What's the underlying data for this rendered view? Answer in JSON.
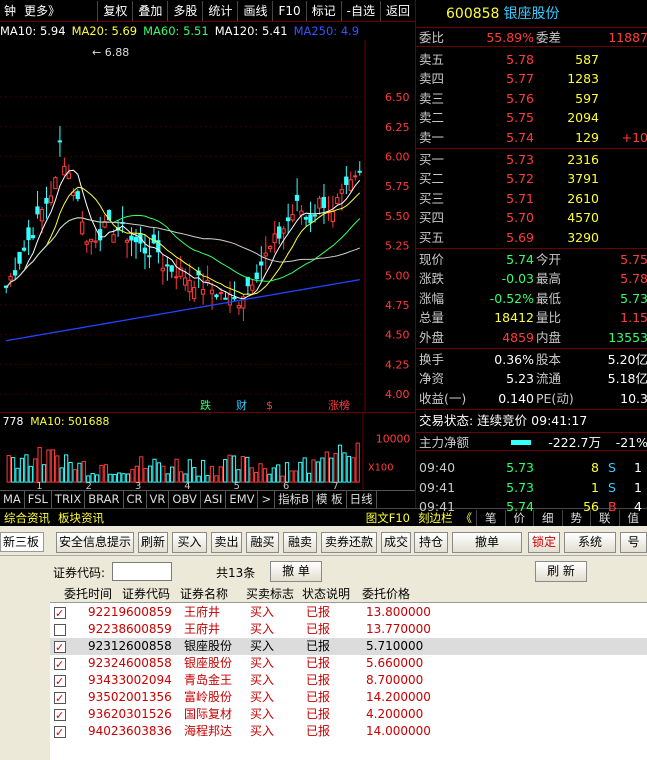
{
  "toolbar": {
    "left_label": "钟",
    "more": "更多》",
    "buttons": [
      "复权",
      "叠加",
      "多股",
      "统计",
      "画线",
      "F10",
      "标记",
      "-自选",
      "返回"
    ]
  },
  "legend": {
    "ma5": "MA10: 5.94",
    "ma20": "MA20: 5.69",
    "ma60": "MA60: 5.51",
    "ma120": "MA120: 5.41",
    "ma250": "MA250: 4.9",
    "peak_label": "6.88"
  },
  "chart_data": {
    "type": "candlestick",
    "yticks": [
      "6.50",
      "6.25",
      "6.00",
      "5.75",
      "5.50",
      "5.25",
      "5.00",
      "4.75",
      "4.50",
      "4.25",
      "4.00"
    ],
    "ylim": [
      3.85,
      6.98
    ],
    "high_annotation": 6.88,
    "low_annotation": 4.37,
    "event_markers": [
      "跌",
      "财",
      "$",
      "涨榜"
    ],
    "volume": {
      "legend_a": "778",
      "legend_b": "MA10: 501688",
      "ytick": "10000",
      "unit": "X100"
    },
    "x_markers": [
      "1",
      "2",
      "3",
      "4",
      "5",
      "6",
      "7"
    ]
  },
  "chart_tabs": [
    "MA",
    "FSL",
    "TRIX",
    "BRAR",
    "CR",
    "VR",
    "OBV",
    "ASI",
    "EMV",
    ">",
    "指标B",
    "模 板",
    "日线"
  ],
  "lower_tabs": {
    "left": [
      "综合资讯",
      "板块资讯"
    ],
    "mid": [
      "图文F10",
      "刻边栏",
      "《"
    ],
    "right": [
      "笔",
      "价",
      "细",
      "势",
      "联",
      "值"
    ]
  },
  "quote": {
    "code": "600858",
    "name": "银座股份",
    "ratio_label": "委比",
    "ratio": "55.89%",
    "diff_label": "委差",
    "diff": "11887",
    "asks": [
      {
        "l": "卖五",
        "p": "5.78",
        "v": "587"
      },
      {
        "l": "卖四",
        "p": "5.77",
        "v": "1283"
      },
      {
        "l": "卖三",
        "p": "5.76",
        "v": "597"
      },
      {
        "l": "卖二",
        "p": "5.75",
        "v": "2094"
      },
      {
        "l": "卖一",
        "p": "5.74",
        "v": "129",
        "e": "+10"
      }
    ],
    "bids": [
      {
        "l": "买一",
        "p": "5.73",
        "v": "2316"
      },
      {
        "l": "买二",
        "p": "5.72",
        "v": "3791"
      },
      {
        "l": "买三",
        "p": "5.71",
        "v": "2610"
      },
      {
        "l": "买四",
        "p": "5.70",
        "v": "4570"
      },
      {
        "l": "买五",
        "p": "5.69",
        "v": "3290"
      }
    ],
    "stats": [
      {
        "l": "现价",
        "a": "5.74",
        "l2": "今开",
        "b": "5.75"
      },
      {
        "l": "涨跌",
        "a": "-0.03",
        "l2": "最高",
        "b": "5.78"
      },
      {
        "l": "涨幅",
        "a": "-0.52%",
        "l2": "最低",
        "b": "5.73"
      },
      {
        "l": "总量",
        "a": "18412",
        "l2": "量比",
        "b": "1.15"
      },
      {
        "l": "外盘",
        "a": "4859",
        "l2": "内盘",
        "b": "13553"
      }
    ],
    "stats2": [
      {
        "l": "换手",
        "a": "0.36%",
        "l2": "股本",
        "b": "5.20亿"
      },
      {
        "l": "净资",
        "a": "5.23",
        "l2": "流通",
        "b": "5.18亿"
      },
      {
        "l": "收益(一)",
        "a": "0.140",
        "l2": "PE(动)",
        "b": "10.3"
      }
    ],
    "status": "交易状态: 连续竞价 09:41:17",
    "flow_label": "主力净额",
    "flow_val": "-222.7万",
    "flow_pct": "-21%",
    "ticks": [
      {
        "t": "09:40",
        "p": "5.73",
        "v": "8",
        "s": "S",
        "n": "1"
      },
      {
        "t": "09:41",
        "p": "5.73",
        "v": "1",
        "s": "S",
        "n": "1"
      },
      {
        "t": "09:41",
        "p": "5.74",
        "v": "56",
        "s": "B",
        "n": "4"
      }
    ]
  },
  "trade": {
    "left_tab": "新三板",
    "buttons": [
      "安全信息提示",
      "刷新",
      "买入",
      "卖出",
      "融买",
      "融卖",
      "卖券还款",
      "成交",
      "持仓",
      "撤单",
      "锁定",
      "系统",
      "号"
    ],
    "code_label": "证券代码:",
    "code_value": "",
    "count": "共13条",
    "cancel": "撤 单",
    "refresh": "刷 新",
    "headers": [
      "委托时间",
      "证券代码",
      "证券名称",
      "买卖标志",
      "状态说明",
      "委托价格"
    ],
    "rows": [
      {
        "chk": true,
        "t": "92219",
        "c": "600859",
        "n": "王府井",
        "d": "买入",
        "s": "已报",
        "p": "13.800000"
      },
      {
        "chk": false,
        "t": "92238",
        "c": "600859",
        "n": "王府井",
        "d": "买入",
        "s": "已报",
        "p": "13.770000"
      },
      {
        "chk": true,
        "t": "92312",
        "c": "600858",
        "n": "银座股份",
        "d": "买入",
        "s": "已报",
        "p": "5.710000"
      },
      {
        "chk": true,
        "t": "92324",
        "c": "600858",
        "n": "银座股份",
        "d": "买入",
        "s": "已报",
        "p": "5.660000"
      },
      {
        "chk": true,
        "t": "93433",
        "c": "002094",
        "n": "青岛金王",
        "d": "买入",
        "s": "已报",
        "p": "8.700000"
      },
      {
        "chk": true,
        "t": "93502",
        "c": "001356",
        "n": "富岭股份",
        "d": "买入",
        "s": "已报",
        "p": "14.200000"
      },
      {
        "chk": true,
        "t": "93620",
        "c": "301526",
        "n": "国际复材",
        "d": "买入",
        "s": "已报",
        "p": "4.200000"
      },
      {
        "chk": true,
        "t": "94023",
        "c": "603836",
        "n": "海程邦达",
        "d": "买入",
        "s": "已报",
        "p": "14.000000"
      }
    ]
  }
}
